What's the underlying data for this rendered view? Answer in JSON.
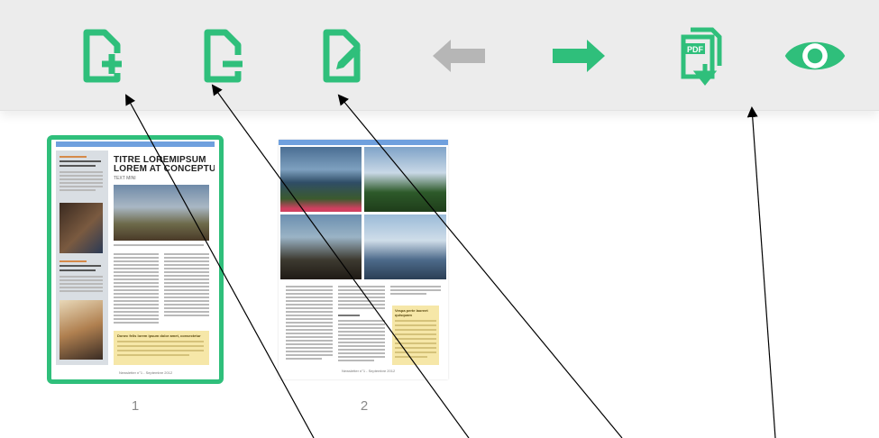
{
  "toolbar": {
    "accent": "#2fbf7b",
    "disabled": "#b6b6b6",
    "buttons": [
      {
        "icon": "page-add-icon",
        "enabled": true
      },
      {
        "icon": "page-remove-icon",
        "enabled": true
      },
      {
        "icon": "page-edit-icon",
        "enabled": true
      },
      {
        "icon": "arrow-left-icon",
        "enabled": false
      },
      {
        "icon": "arrow-right-icon",
        "enabled": true
      },
      {
        "icon": "pdf-export-icon",
        "enabled": true
      },
      {
        "icon": "eye-preview-icon",
        "enabled": true
      }
    ]
  },
  "pages": [
    {
      "number": "1",
      "selected": true,
      "title_line1": "TITRE LOREMIPSUM",
      "title_line2": "LOREM AT CONCEPTUER",
      "subtitle": "TEXT MINI",
      "box_title": "Donec felis lorem ipsum dolor amet, consectetur",
      "footer": "Newsletter n°1 - Septembre 2012"
    },
    {
      "number": "2",
      "selected": false,
      "box_title": "Vespa perte laoreet quisquam",
      "footer": "Newsletter n°1 - Septembre 2012"
    }
  ]
}
